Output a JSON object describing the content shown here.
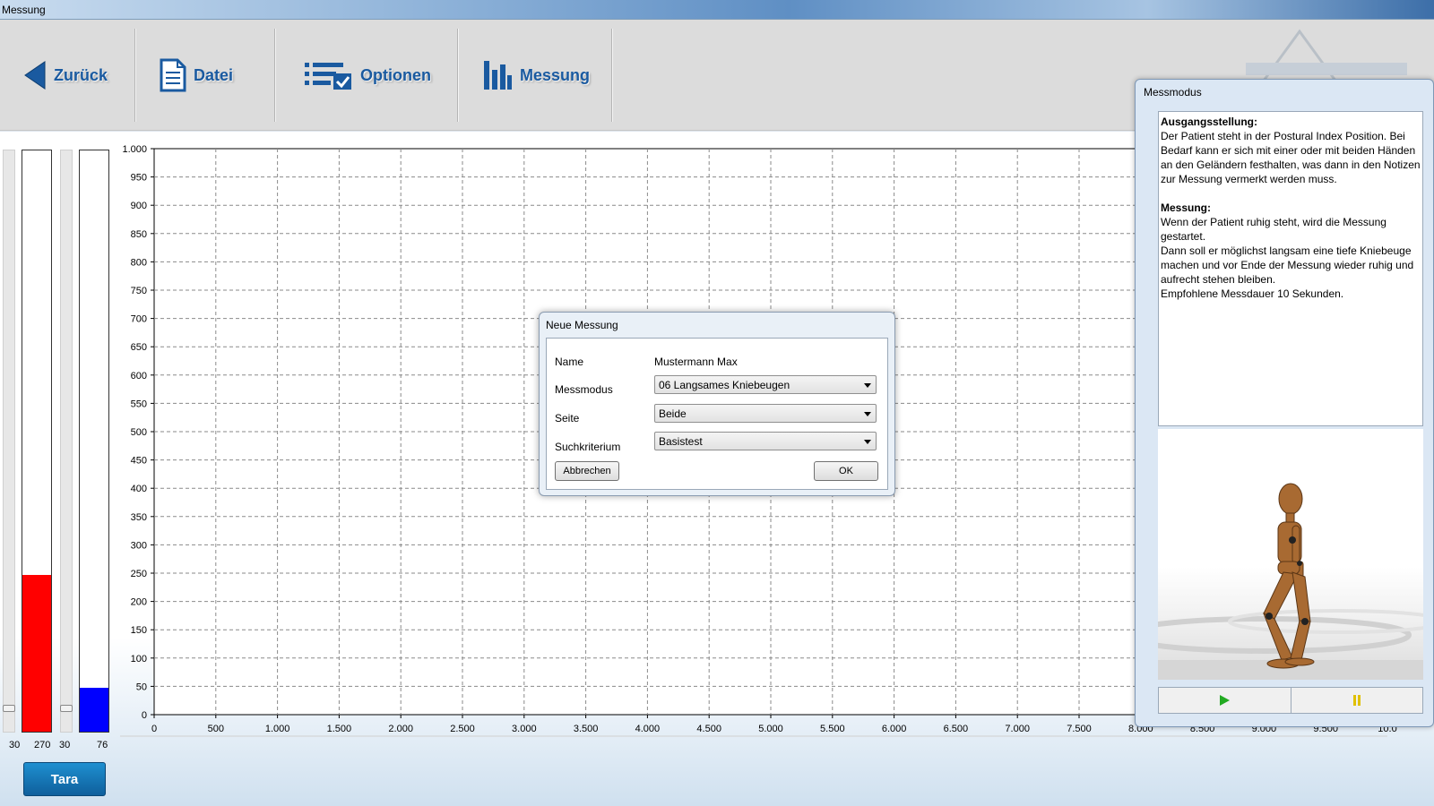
{
  "window": {
    "title": "Messung"
  },
  "toolbar": {
    "back_label": "Zurück",
    "file_label": "Datei",
    "options_label": "Optionen",
    "measure_label": "Messung"
  },
  "bars": {
    "left_min": "30",
    "left_value": "270",
    "right_min": "30",
    "right_value": "76",
    "left_color": "#ff0000",
    "right_color": "#0000ff",
    "left_fraction": 0.27,
    "right_fraction": 0.076
  },
  "tara_label": "Tara",
  "chart_data": {
    "type": "line",
    "title": "",
    "xlabel": "",
    "ylabel": "",
    "xlim": [
      0,
      10000
    ],
    "ylim": [
      0,
      1000
    ],
    "grid": true,
    "x_ticks": [
      "0",
      "500",
      "1.000",
      "1.500",
      "2.000",
      "2.500",
      "3.000",
      "3.500",
      "4.000",
      "4.500",
      "5.000",
      "5.500",
      "6.000",
      "6.500",
      "7.000",
      "7.500",
      "8.000",
      "8.500",
      "9.000",
      "9.500",
      "10.0"
    ],
    "y_ticks": [
      "0",
      "50",
      "100",
      "150",
      "200",
      "250",
      "300",
      "350",
      "400",
      "450",
      "500",
      "550",
      "600",
      "650",
      "700",
      "750",
      "800",
      "850",
      "900",
      "950",
      "1.000"
    ],
    "series": []
  },
  "dialog": {
    "title": "Neue Messung",
    "name_label": "Name",
    "name_value": "Mustermann Max",
    "mode_label": "Messmodus",
    "mode_value": "06 Langsames Kniebeugen",
    "side_label": "Seite",
    "side_value": "Beide",
    "criteria_label": "Suchkriterium",
    "criteria_value": "Basistest",
    "cancel_label": "Abbrechen",
    "ok_label": "OK"
  },
  "panel": {
    "title": "Messmodus",
    "heading1": "Ausgangsstellung:",
    "text1": "Der Patient steht in der Postural Index Position. Bei Bedarf kann er sich mit einer oder mit beiden Händen an den Geländern festhalten, was dann in den Notizen zur Messung vermerkt werden muss.",
    "heading2": "Messung:",
    "text2a": "Wenn der Patient ruhig  steht, wird die Messung gestartet.",
    "text2b": "Dann soll er möglichst langsam eine tiefe Kniebeuge machen und vor Ende der Messung wieder ruhig und aufrecht stehen bleiben.",
    "text2c": "Empfohlene Messdauer 10 Sekunden.",
    "play_color": "#22aa22",
    "pause_color": "#e0c000"
  }
}
